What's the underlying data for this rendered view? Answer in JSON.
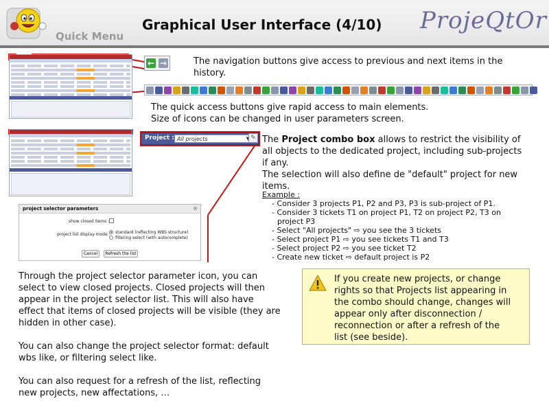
{
  "header": {
    "quick_menu_label": "Quick Menu",
    "title": "Graphical User Interface (4/10)",
    "brand": "ProjeQtOr"
  },
  "nav_section": {
    "line1": "The navigation buttons give access to previous and next items in the",
    "line2": "history."
  },
  "quick_section": {
    "line1": "The quick access buttons give rapid access to main elements.",
    "line2": "Size of icons can be changed in user parameters screen."
  },
  "combo": {
    "label": "Project :",
    "value": "All projects"
  },
  "combo_section": {
    "line1_pre": "The ",
    "line1_bold": "Project combo box",
    "line1_post": " allows to restrict the visibility of",
    "line2": "all objects to the dedicated project, including sub-projects",
    "line3": "if any.",
    "line4": "The selection will also define de \"default\" project for new",
    "line5": "items."
  },
  "example": {
    "title": "Example :",
    "items": [
      "- Consider 3 projects P1, P2 and P3, P3 is sub-project of P1.",
      "- Consider 3 tickets T1 on project P1, T2 on project P2, T3 on",
      "project P3",
      "- Select \"All projects\" ⇨ you see the 3 tickets",
      "- Select project P1 ⇨ you see tickets T1 and T3",
      "- Select project P2 ⇨ you see ticket T2",
      "- Create new ticket ⇨ default project is P2"
    ]
  },
  "dialog": {
    "title": "project selector parameters",
    "show_closed_label": "show closed items :",
    "display_mode_label": "project list display mode :",
    "option_standard": "standard (reflecting WBS structure)",
    "option_filtering": "filtering select (with autocomplete)",
    "cancel": "Cancel",
    "refresh": "Refresh the list"
  },
  "bottom_text": {
    "p1": [
      "Through the project selector parameter icon, you can",
      "select to view closed projects. Closed projects will then",
      "appear in the project selector list. This will also have",
      "effect that items of closed projects will be visible (they are",
      "hidden in other case)."
    ],
    "p2": [
      "You can also change the project selector format: default",
      "wbs like, or filtering select like."
    ],
    "p3": [
      "You can also request for a refresh of the list, reflecting",
      "new projects, new affectations, …"
    ]
  },
  "warning": {
    "lines": [
      "If you create new projects, or change",
      "rights so that Projects list appearing in",
      "the combo should change, changes will",
      "appear only after disconnection /",
      "reconnection or after a refresh of the",
      "list (see beside)."
    ]
  },
  "colors": {
    "accent_red": "#cc1111",
    "toolbar_blue": "#4a5a9a",
    "warning_bg": "#fdfbc8"
  }
}
